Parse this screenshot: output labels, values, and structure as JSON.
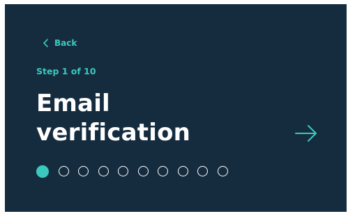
{
  "nav": {
    "back_label": "Back"
  },
  "wizard": {
    "step_label": "Step 1 of 10",
    "title_line1": "Email",
    "title_line2": "verification",
    "current_step": 1,
    "total_steps": 10
  },
  "icons": {
    "back": "chevron-left-icon",
    "next": "arrow-right-icon"
  },
  "colors": {
    "background": "#152c3f",
    "accent": "#3cc9bd",
    "text": "#ffffff"
  }
}
